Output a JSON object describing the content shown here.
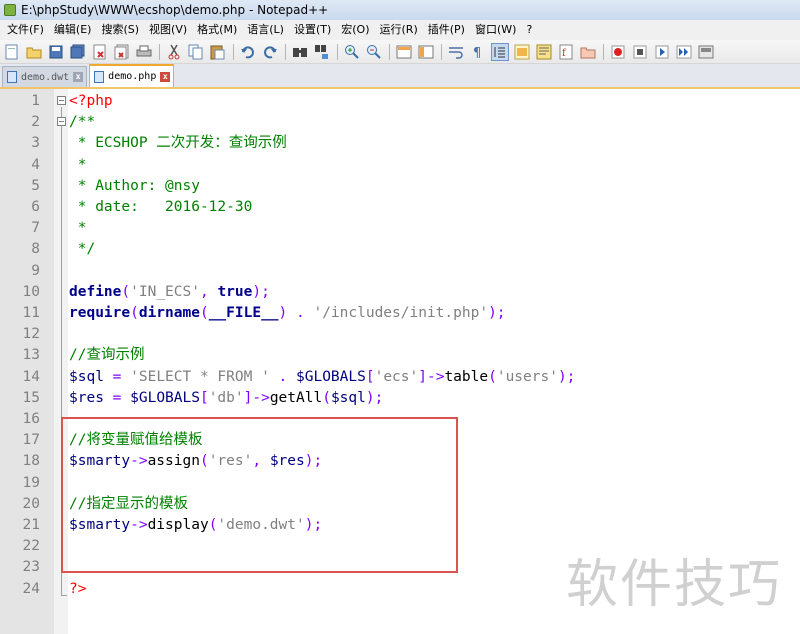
{
  "window": {
    "title": "E:\\phpStudy\\WWW\\ecshop\\demo.php - Notepad++"
  },
  "menu": {
    "items": [
      "文件(F)",
      "编辑(E)",
      "搜索(S)",
      "视图(V)",
      "格式(M)",
      "语言(L)",
      "设置(T)",
      "宏(O)",
      "运行(R)",
      "插件(P)",
      "窗口(W)",
      "?"
    ]
  },
  "toolbar": {
    "icons": [
      "new-file-icon",
      "open-file-icon",
      "save-icon",
      "save-all-icon",
      "close-icon",
      "close-all-icon",
      "print-icon",
      "cut-icon",
      "copy-icon",
      "paste-icon",
      "undo-icon",
      "redo-icon",
      "find-icon",
      "replace-icon",
      "zoom-in-icon",
      "zoom-out-icon",
      "sync-v-icon",
      "sync-h-icon",
      "word-wrap-icon",
      "show-all-chars-icon",
      "indent-guide-icon",
      "udl-icon",
      "doc-map-icon",
      "function-list-icon",
      "folder-workspace-icon",
      "record-macro-icon",
      "stop-record-icon",
      "play-macro-icon",
      "play-multiple-icon",
      "save-macro-icon"
    ]
  },
  "tabs": [
    {
      "label": "demo.dwt",
      "active": false
    },
    {
      "label": "demo.php",
      "active": true
    }
  ],
  "editor": {
    "line_numbers": [
      "1",
      "2",
      "3",
      "4",
      "5",
      "6",
      "7",
      "8",
      "9",
      "10",
      "11",
      "12",
      "13",
      "14",
      "15",
      "16",
      "17",
      "18",
      "19",
      "20",
      "21",
      "22",
      "23",
      "24"
    ],
    "lines": {
      "l1": {
        "php_open": "<?php"
      },
      "l2": {
        "comment": "/**"
      },
      "l3": {
        "comment": " * ECSHOP 二次开发：查询示例"
      },
      "l4": {
        "comment": " *"
      },
      "l5": {
        "comment": " * Author: @nsy"
      },
      "l6": {
        "comment": " * date:   2016-12-30"
      },
      "l7": {
        "comment": " *"
      },
      "l8": {
        "comment": " */"
      },
      "l10": {
        "kw1": "define",
        "p1": "(",
        "s1": "'IN_ECS'",
        "p2": ", ",
        "kw2": "true",
        "p3": ");"
      },
      "l11": {
        "kw1": "require",
        "p1": "(",
        "kw2": "dirname",
        "p2": "(",
        "kw3": "__FILE__",
        "p3": ")",
        "p4": " . ",
        "s1": "'/includes/init.php'",
        "p5": ");"
      },
      "l13": {
        "comment": "//查询示例"
      },
      "l14": {
        "v1": "$sql",
        "p1": " = ",
        "s1": "'SELECT * FROM '",
        "p2": " . ",
        "v2": "$GLOBALS",
        "p3": "[",
        "s2": "'ecs'",
        "p4": "]->",
        "f1": "table",
        "p5": "(",
        "s3": "'users'",
        "p6": ");"
      },
      "l15": {
        "v1": "$res",
        "p1": " = ",
        "v2": "$GLOBALS",
        "p2": "[",
        "s1": "'db'",
        "p3": "]->",
        "f1": "getAll",
        "p4": "(",
        "v3": "$sql",
        "p5": ");"
      },
      "l17": {
        "comment": "//将变量赋值给模板"
      },
      "l18": {
        "v1": "$smarty",
        "p1": "->",
        "f1": "assign",
        "p2": "(",
        "s1": "'res'",
        "p3": ", ",
        "v2": "$res",
        "p4": ");"
      },
      "l20": {
        "comment": "//指定显示的模板"
      },
      "l21": {
        "v1": "$smarty",
        "p1": "->",
        "f1": "display",
        "p2": "(",
        "s1": "'demo.dwt'",
        "p3": ");"
      },
      "l24": {
        "php_close": "?>"
      }
    }
  },
  "colors": {
    "highlight_box": "#d9534f",
    "comment": "#008000",
    "keyword": "#00008b",
    "string": "#808080",
    "php_tag": "#ff0000"
  },
  "watermark": {
    "text": "软件技巧"
  }
}
